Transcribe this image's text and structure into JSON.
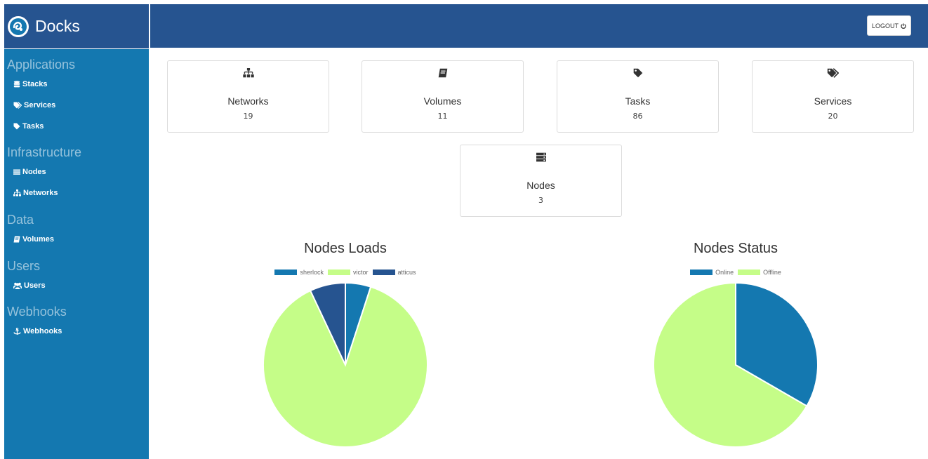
{
  "brand": {
    "title": "Docks"
  },
  "topbar": {
    "logout_label": "LOGOUT"
  },
  "sidebar": {
    "sections": [
      {
        "title": "Applications",
        "items": [
          {
            "label": "Stacks",
            "icon": "database-icon"
          },
          {
            "label": "Services",
            "icon": "tags-icon"
          },
          {
            "label": "Tasks",
            "icon": "tag-icon"
          }
        ]
      },
      {
        "title": "Infrastructure",
        "items": [
          {
            "label": "Nodes",
            "icon": "list-icon"
          },
          {
            "label": "Networks",
            "icon": "sitemap-icon"
          }
        ]
      },
      {
        "title": "Data",
        "items": [
          {
            "label": "Volumes",
            "icon": "book-icon"
          }
        ]
      },
      {
        "title": "Users",
        "items": [
          {
            "label": "Users",
            "icon": "users-icon"
          }
        ]
      },
      {
        "title": "Webhooks",
        "items": [
          {
            "label": "Webhooks",
            "icon": "anchor-icon"
          }
        ]
      }
    ]
  },
  "cards": [
    {
      "title": "Networks",
      "count": "19",
      "icon": "sitemap-icon"
    },
    {
      "title": "Volumes",
      "count": "11",
      "icon": "book-icon"
    },
    {
      "title": "Tasks",
      "count": "86",
      "icon": "tag-icon"
    },
    {
      "title": "Services",
      "count": "20",
      "icon": "tags-icon"
    },
    {
      "title": "Nodes",
      "count": "3",
      "icon": "server-icon"
    }
  ],
  "chart_data": [
    {
      "type": "pie",
      "title": "Nodes Loads",
      "categories": [
        "sherlock",
        "victor",
        "atticus"
      ],
      "values": [
        5,
        88,
        7
      ],
      "colors": [
        "#1478b0",
        "#c5fd88",
        "#265490"
      ],
      "legend": "top-center"
    },
    {
      "type": "pie",
      "title": "Nodes Status",
      "categories": [
        "Online",
        "Offline"
      ],
      "values": [
        1,
        2
      ],
      "colors": [
        "#1478b0",
        "#c5fd88"
      ],
      "legend": "top-center"
    }
  ]
}
